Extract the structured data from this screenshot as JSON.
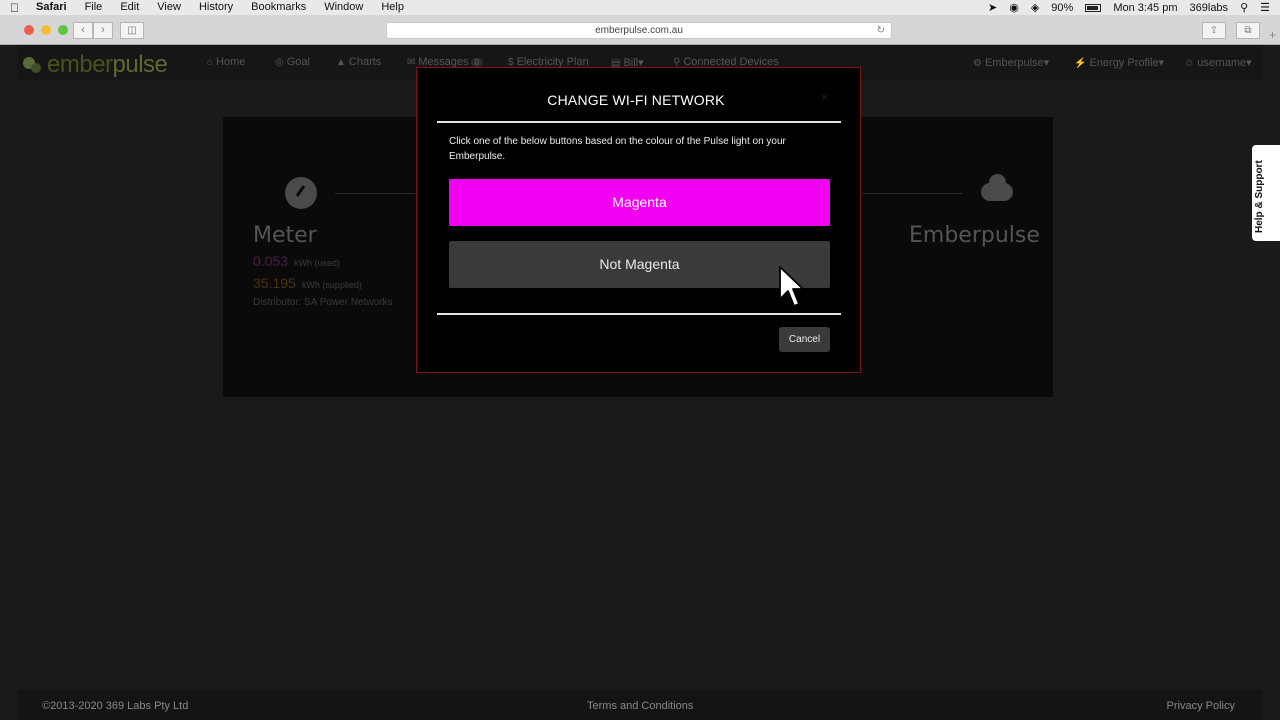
{
  "menubar": {
    "app_name": "Safari",
    "items": [
      "File",
      "Edit",
      "View",
      "History",
      "Bookmarks",
      "Window",
      "Help"
    ],
    "battery": "90%",
    "clock": "Mon 3:45 pm",
    "user": "369labs"
  },
  "browser": {
    "url": "emberpulse.com.au"
  },
  "site": {
    "logo_prefix": "ember",
    "logo_suffix": "pulse",
    "nav": {
      "home": "Home",
      "goal": "Goal",
      "charts": "Charts",
      "messages": "Messages",
      "messages_count": "0",
      "electricity_plan": "Electricity Plan",
      "bill": "Bill",
      "connected_devices": "Connected Devices",
      "emberpulse": "Emberpulse",
      "energy_profile": "Energy Profile",
      "username": "username"
    },
    "panel": {
      "meter_title": "Meter",
      "used_value": "0.053",
      "used_unit": "kWh (used)",
      "supplied_value": "35.195",
      "supplied_unit": "kWh (supplied)",
      "distributor": "Distributor:  SA Power Networks",
      "emberpulse_title": "Emberpulse"
    },
    "help_tab": "Help & Support",
    "footer": {
      "copyright": "©2013-2020 369 Labs Pty Ltd",
      "terms": "Terms and Conditions",
      "privacy": "Privacy Policy"
    }
  },
  "modal": {
    "title": "CHANGE WI-FI NETWORK",
    "instructions": "Click one of the below buttons based on the colour of the Pulse light on your Emberpulse.",
    "magenta_button": "Magenta",
    "not_magenta_button": "Not Magenta",
    "cancel_button": "Cancel",
    "close_glyph": "×"
  },
  "colors": {
    "magenta": "#f200f2",
    "logo_green": "#5b6a33"
  }
}
